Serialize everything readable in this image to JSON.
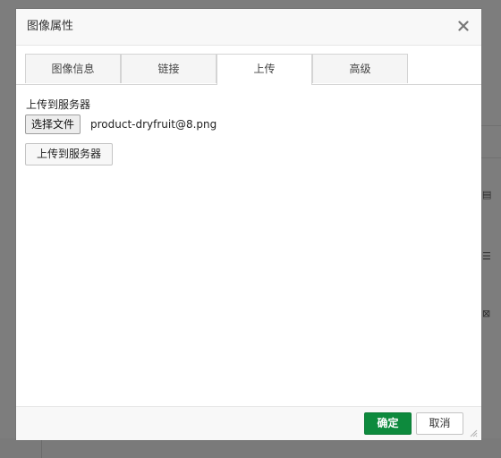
{
  "dialog": {
    "title": "图像属性",
    "close_icon": "close-icon"
  },
  "tabs": [
    {
      "label": "图像信息",
      "active": false
    },
    {
      "label": "链接",
      "active": false
    },
    {
      "label": "上传",
      "active": true
    },
    {
      "label": "高级",
      "active": false
    }
  ],
  "upload": {
    "label": "上传到服务器",
    "file_button_label": "选择文件",
    "file_name": "product-dryfruit@8.png",
    "upload_button_label": "上传到服务器"
  },
  "footer": {
    "ok_label": "确定",
    "cancel_label": "取消",
    "ok_color": "#0d8a3d"
  }
}
